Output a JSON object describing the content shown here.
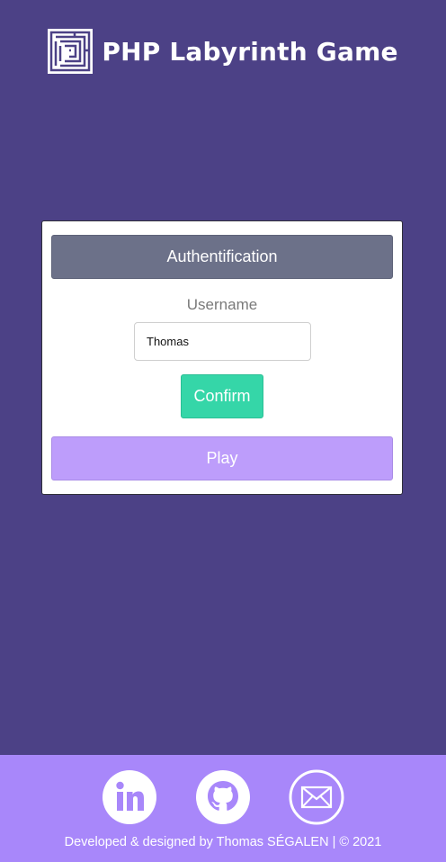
{
  "header": {
    "title": "PHP Labyrinth Game",
    "logo_icon": "maze-icon"
  },
  "card": {
    "auth_title": "Authentification",
    "username_label": "Username",
    "username_value": "Thomas",
    "confirm_label": "Confirm",
    "play_label": "Play"
  },
  "footer": {
    "social": [
      {
        "icon": "linkedin-icon"
      },
      {
        "icon": "github-icon"
      },
      {
        "icon": "mail-icon"
      }
    ],
    "credits": "Developed & designed by Thomas SÉGALEN | © 2021"
  },
  "colors": {
    "background": "#4c4186",
    "auth_header": "#6c7189",
    "confirm": "#35d6a8",
    "play": "#bd9dfb",
    "footer": "#a887fa"
  }
}
